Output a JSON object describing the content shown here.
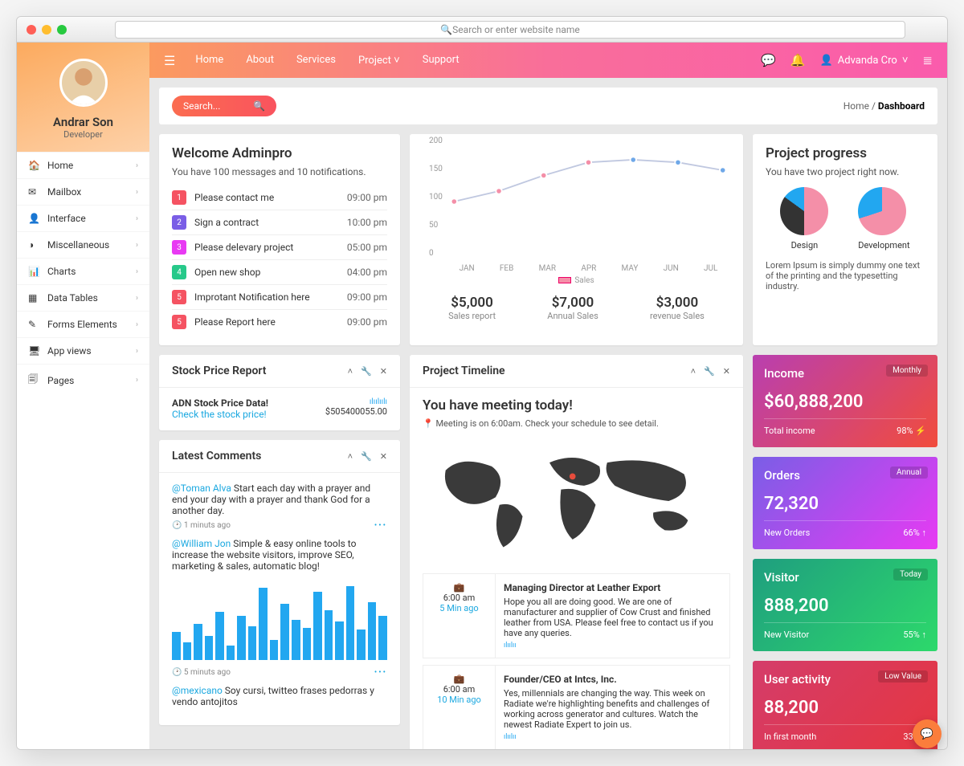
{
  "browser": {
    "placeholder": "Search or enter website name"
  },
  "sidebar": {
    "user": {
      "name": "Andrar Son",
      "role": "Developer"
    },
    "items": [
      {
        "icon": "🏠",
        "label": "Home"
      },
      {
        "icon": "✉",
        "label": "Mailbox"
      },
      {
        "icon": "👤",
        "label": "Interface"
      },
      {
        "icon": "◑",
        "label": "Miscellaneous"
      },
      {
        "icon": "📊",
        "label": "Charts"
      },
      {
        "icon": "▦",
        "label": "Data Tables"
      },
      {
        "icon": "✎",
        "label": "Forms Elements"
      },
      {
        "icon": "🖥",
        "label": "App views"
      },
      {
        "icon": "🗐",
        "label": "Pages"
      }
    ]
  },
  "topnav": {
    "items": [
      "Home",
      "About",
      "Services",
      "Project",
      "Support"
    ],
    "user": "Advanda Cro"
  },
  "search": {
    "placeholder": "Search..."
  },
  "crumbs": {
    "root": "Home",
    "current": "Dashboard"
  },
  "welcome": {
    "title": "Welcome Adminpro",
    "sub": "You have 100 messages and 10 notifications.",
    "tasks": [
      {
        "n": "1",
        "c": "#f55362",
        "t": "Please contact me",
        "time": "09:00 pm"
      },
      {
        "n": "2",
        "c": "#7a5ee6",
        "t": "Sign a contract",
        "time": "10:00 pm"
      },
      {
        "n": "3",
        "c": "#e83af3",
        "t": "Please delevary project",
        "time": "05:00 pm"
      },
      {
        "n": "4",
        "c": "#27c98a",
        "t": "Open new shop",
        "time": "04:00 pm"
      },
      {
        "n": "5",
        "c": "#f55362",
        "t": "Improtant Notification here",
        "time": "09:00 pm"
      },
      {
        "n": "5",
        "c": "#f55362",
        "t": "Please Report here",
        "time": "09:00 pm"
      }
    ]
  },
  "chart_data": {
    "type": "line",
    "categories": [
      "JAN",
      "FEB",
      "MAR",
      "APR",
      "MAY",
      "JUN",
      "JUL"
    ],
    "series": [
      {
        "name": "Sales",
        "values": [
          100,
          120,
          150,
          175,
          180,
          175,
          160
        ]
      }
    ],
    "ylim": [
      0,
      200
    ],
    "yticks": [
      0,
      50,
      100,
      150,
      200
    ]
  },
  "chart_stats": [
    {
      "v": "$5,000",
      "l": "Sales report"
    },
    {
      "v": "$7,000",
      "l": "Annual Sales"
    },
    {
      "v": "$3,000",
      "l": "revenue Sales"
    }
  ],
  "progress": {
    "title": "Project progress",
    "sub": "You have two project right now.",
    "pies": [
      {
        "label": "Design",
        "slices": [
          [
            "#f48fa8",
            50
          ],
          [
            "#333",
            35
          ],
          [
            "#22a7f0",
            15
          ]
        ]
      },
      {
        "label": "Development",
        "slices": [
          [
            "#f48fa8",
            70
          ],
          [
            "#22a7f0",
            30
          ]
        ]
      }
    ],
    "blurb": "Lorem Ipsum is simply dummy one text of the printing and the typesetting industry."
  },
  "stock": {
    "title": "Stock Price Report",
    "head": "ADN Stock Price Data!",
    "link": "Check the stock price!",
    "val": "$505400055.00"
  },
  "comments": {
    "title": "Latest Comments",
    "items": [
      {
        "user": "@Toman Alva",
        "text": "Start each day with a prayer and end your day with a prayer and thank God for a another day.",
        "ago": "1 minuts ago"
      },
      {
        "user": "@William Jon",
        "text": "Simple & easy online tools to increase the website visitors, improve SEO, marketing & sales, automatic blog!",
        "ago": "5 minuts ago",
        "bars": [
          35,
          22,
          45,
          30,
          60,
          18,
          55,
          42,
          90,
          25,
          70,
          50,
          40,
          85,
          62,
          48,
          92,
          38,
          72,
          55
        ]
      },
      {
        "user": "@mexicano",
        "text": "Soy cursi, twitteo frases pedorras y vendo antojitos"
      }
    ]
  },
  "timeline": {
    "title": "Project Timeline",
    "head": "You have meeting today!",
    "sub": "Meeting is on 6:00am. Check your schedule to see detail.",
    "items": [
      {
        "time": "6:00 am",
        "ago": "5 Min ago",
        "title": "Managing Director at Leather Export",
        "text": "Hope you all are doing good. We are one of manufacturer and supplier of Cow Crust and finished leather from USA. Please feel free to contact us if you have any queries."
      },
      {
        "time": "6:00 am",
        "ago": "10 Min ago",
        "title": "Founder/CEO at Intcs, Inc.",
        "text": "Yes, millennials are changing the way. This week on Radiate we're highlighting benefits and challenges of working across generator and cultures. Watch the newest Radiate Expert to join us."
      }
    ]
  },
  "stats": [
    {
      "cls": "income",
      "title": "Income",
      "tag": "Monthly",
      "val": "$60,888,200",
      "lbl": "Total income",
      "pct": "98% ⚡"
    },
    {
      "cls": "orders",
      "title": "Orders",
      "tag": "Annual",
      "val": "72,320",
      "lbl": "New Orders",
      "pct": "66% ↑"
    },
    {
      "cls": "visitor",
      "title": "Visitor",
      "tag": "Today",
      "val": "888,200",
      "lbl": "New Visitor",
      "pct": "55% ↑"
    },
    {
      "cls": "activity",
      "title": "User activity",
      "tag": "Low Value",
      "val": "88,200",
      "lbl": "In first month",
      "pct": "33% ↑"
    }
  ]
}
